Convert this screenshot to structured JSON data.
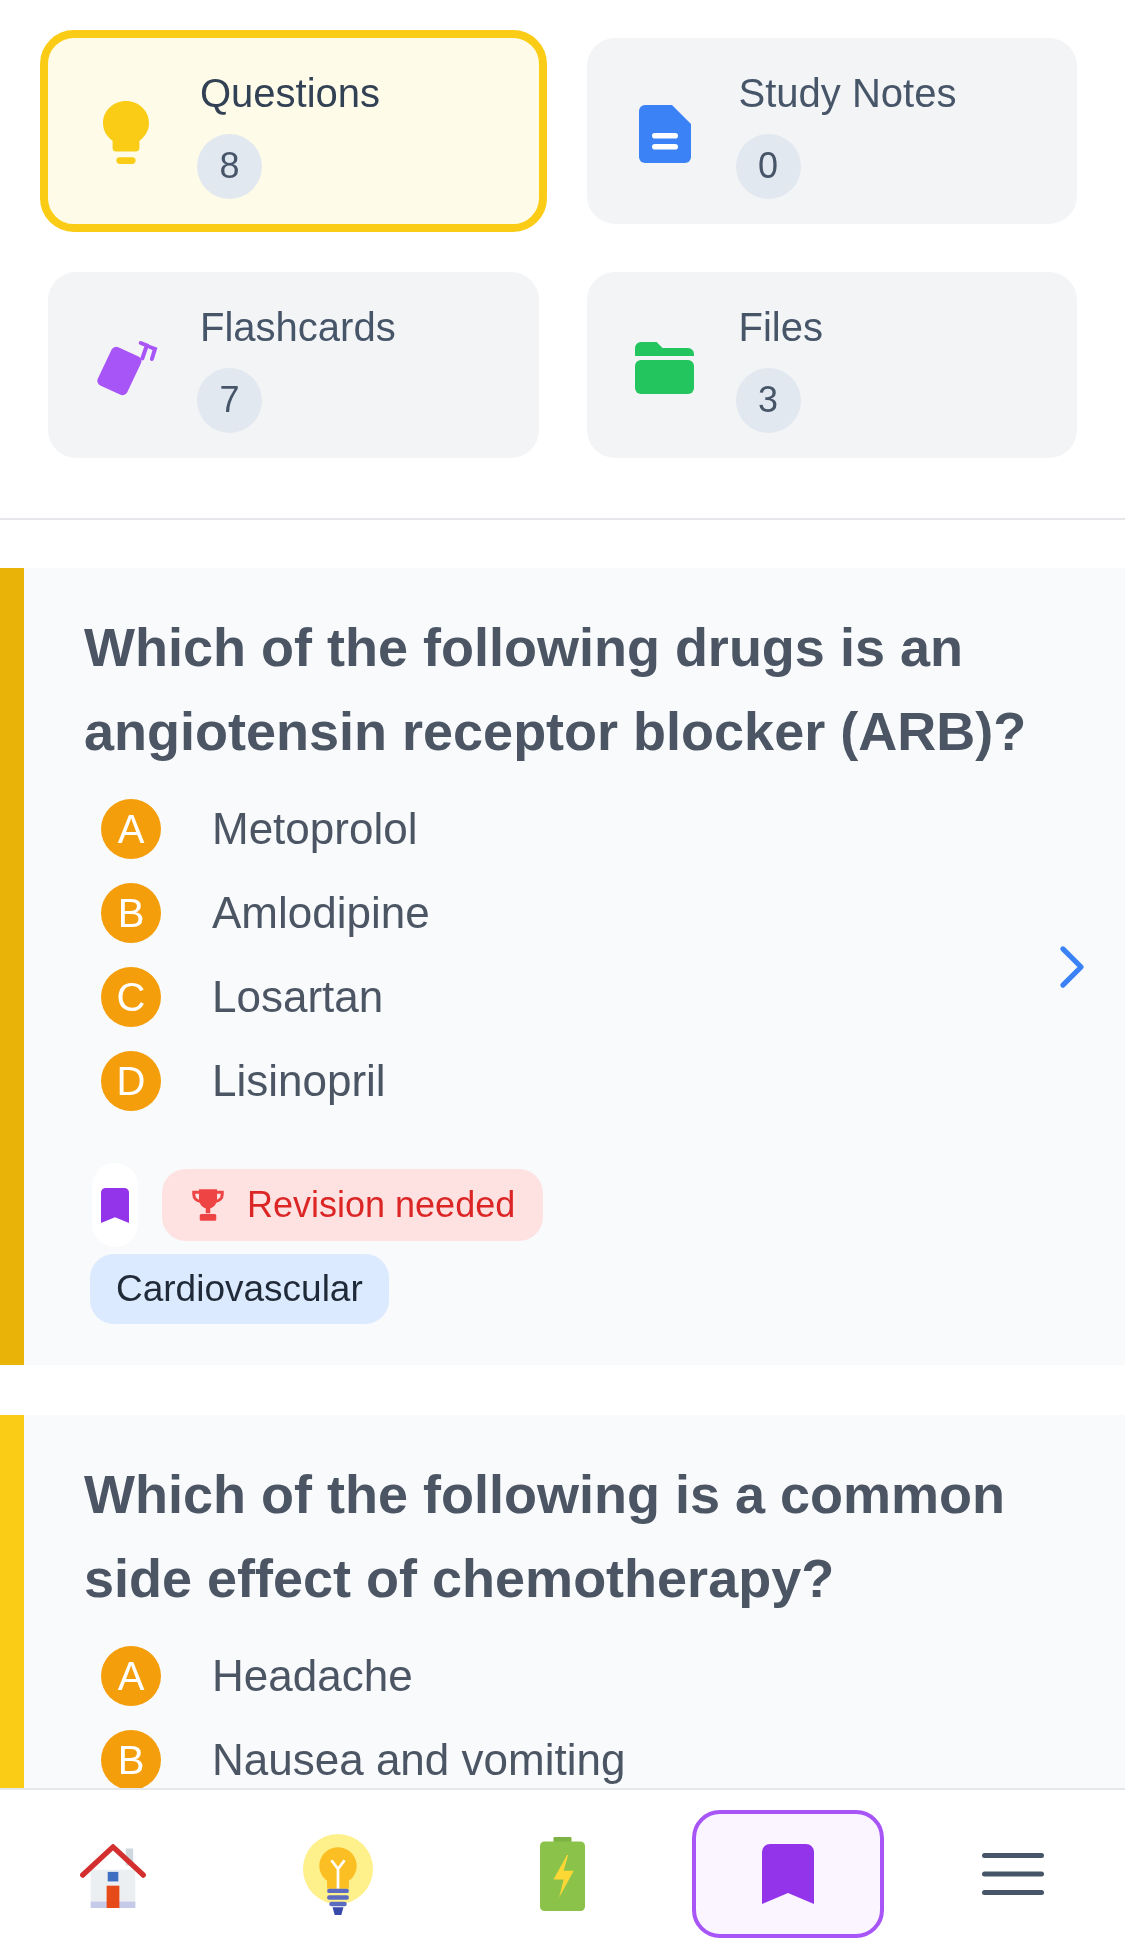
{
  "categories": [
    {
      "kind": "questions",
      "label": "Questions",
      "count": "8",
      "selected": true
    },
    {
      "kind": "notes",
      "label": "Study Notes",
      "count": "0",
      "selected": false
    },
    {
      "kind": "flashcards",
      "label": "Flashcards",
      "count": "7",
      "selected": false
    },
    {
      "kind": "files",
      "label": "Files",
      "count": "3",
      "selected": false
    }
  ],
  "questions": [
    {
      "color": "#eab308",
      "text": "Which of the following drugs is an angiotensin receptor blocker (ARB)?",
      "options": [
        {
          "letter": "A",
          "text": "Metoprolol"
        },
        {
          "letter": "B",
          "text": "Amlodipine"
        },
        {
          "letter": "C",
          "text": "Losartan"
        },
        {
          "letter": "D",
          "text": "Lisinopril"
        }
      ],
      "has_next": true,
      "bookmarked": true,
      "tags": [
        {
          "kind": "status",
          "text": "Revision needed"
        },
        {
          "kind": "topic",
          "text": "Cardiovascular"
        }
      ]
    },
    {
      "color": "#facc15",
      "text": "Which of the following is a common side effect of chemotherapy?",
      "options": [
        {
          "letter": "A",
          "text": "Headache"
        },
        {
          "letter": "B",
          "text": "Nausea and vomiting"
        }
      ]
    }
  ],
  "bottom_nav": [
    {
      "kind": "home",
      "selected": false
    },
    {
      "kind": "bulb",
      "selected": false
    },
    {
      "kind": "battery",
      "selected": false
    },
    {
      "kind": "bookmark",
      "selected": true
    },
    {
      "kind": "menu",
      "selected": false
    }
  ]
}
